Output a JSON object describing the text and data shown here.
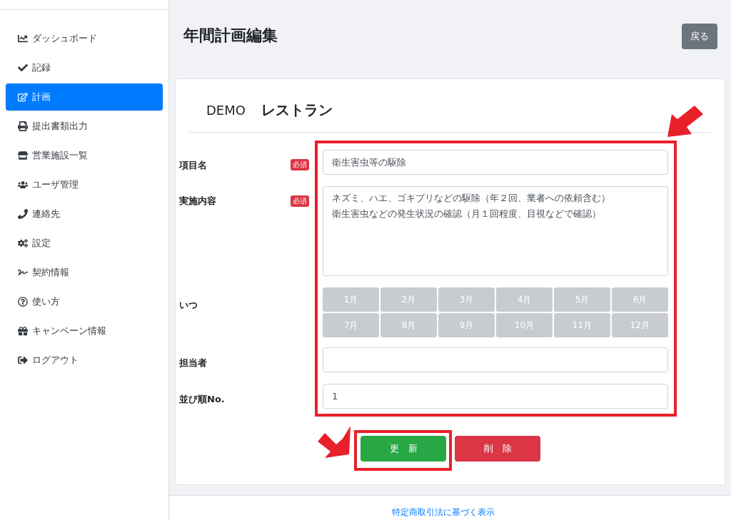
{
  "sidebar": {
    "items": [
      {
        "label": "ダッシュボード",
        "selected": false
      },
      {
        "label": "記録",
        "selected": false
      },
      {
        "label": "計画",
        "selected": true
      },
      {
        "label": "提出書類出力",
        "selected": false
      },
      {
        "label": "営業施設一覧",
        "selected": false
      },
      {
        "label": "ユーザ管理",
        "selected": false
      },
      {
        "label": "連絡先",
        "selected": false
      },
      {
        "label": "設定",
        "selected": false
      },
      {
        "label": "契約情報",
        "selected": false
      },
      {
        "label": "使い方",
        "selected": false
      },
      {
        "label": "キャンペーン情報",
        "selected": false
      },
      {
        "label": "ログアウト",
        "selected": false
      }
    ]
  },
  "page_title": "年間計画編集",
  "back_button": "戻る",
  "facility": {
    "prefix": "DEMO",
    "name": "レストラン"
  },
  "form": {
    "fields": [
      {
        "kind": "input",
        "label": "項目名",
        "required_badge": "必須",
        "value": "衛生害虫等の駆除"
      },
      {
        "kind": "textarea",
        "label": "実施内容",
        "required_badge": "必須",
        "lines": [
          "ネズミ、ハエ、ゴキブリなどの駆除（年２回、業者への依頼含む）",
          "衛生害虫などの発生状況の確認（月１回程度、目視などで確認）"
        ]
      },
      {
        "kind": "months",
        "label": "いつ",
        "months": [
          {
            "label": "1月",
            "selected": false
          },
          {
            "label": "2月",
            "selected": false
          },
          {
            "label": "3月",
            "selected": false
          },
          {
            "label": "4月",
            "selected": false
          },
          {
            "label": "5月",
            "selected": false
          },
          {
            "label": "6月",
            "selected": false
          },
          {
            "label": "7月",
            "selected": false
          },
          {
            "label": "8月",
            "selected": false
          },
          {
            "label": "9月",
            "selected": false
          },
          {
            "label": "10月",
            "selected": false
          },
          {
            "label": "11月",
            "selected": false
          },
          {
            "label": "12月",
            "selected": false
          }
        ]
      },
      {
        "kind": "input",
        "label": "担当者"
      },
      {
        "kind": "input",
        "label": "並び順No.",
        "value": "1"
      }
    ]
  },
  "buttons": {
    "update": "更　新",
    "delete": "削　除"
  },
  "footer_link": "特定商取引法に基づく表示"
}
